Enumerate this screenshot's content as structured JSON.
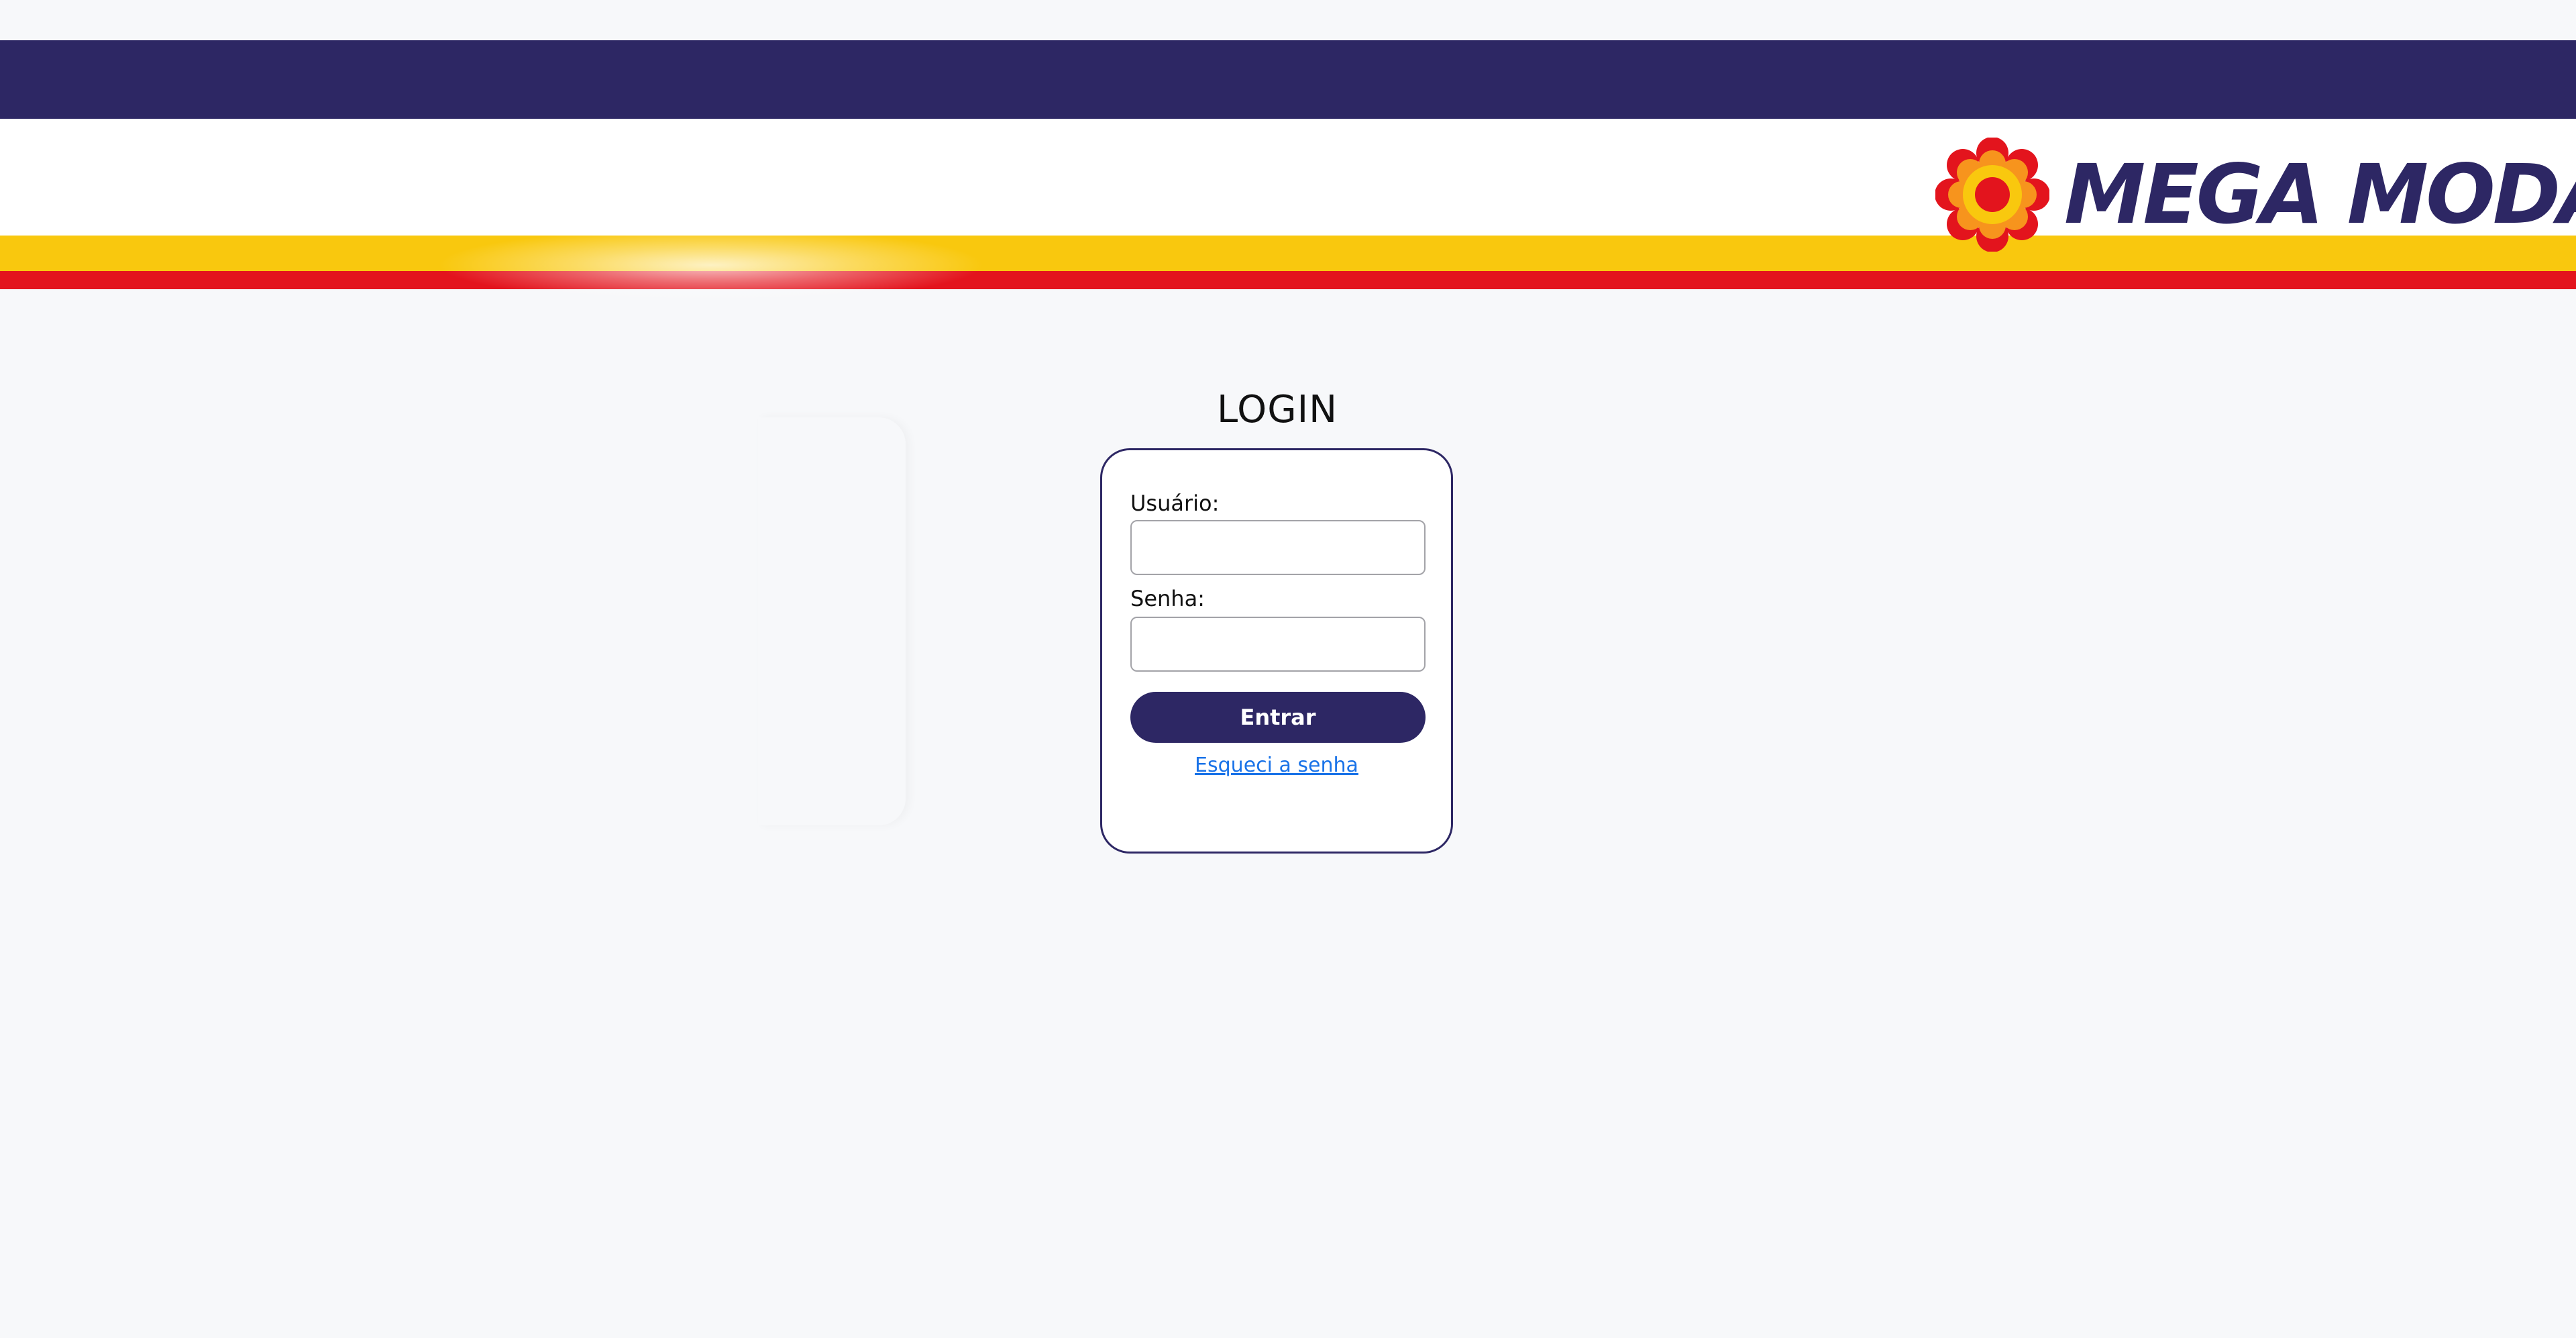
{
  "header": {
    "logo_text": "MEGA MODA",
    "logo_icon": "flower-logo-icon"
  },
  "login": {
    "title": "LOGIN",
    "username_label": "Usuário:",
    "username_value": "",
    "password_label": "Senha:",
    "password_value": "",
    "submit_label": "Entrar",
    "forgot_label": "Esqueci a senha"
  },
  "colors": {
    "navy": "#2d2764",
    "yellow": "#f9c80e",
    "red": "#e3141d",
    "background": "#f7f8fa",
    "link": "#1a73e8"
  }
}
